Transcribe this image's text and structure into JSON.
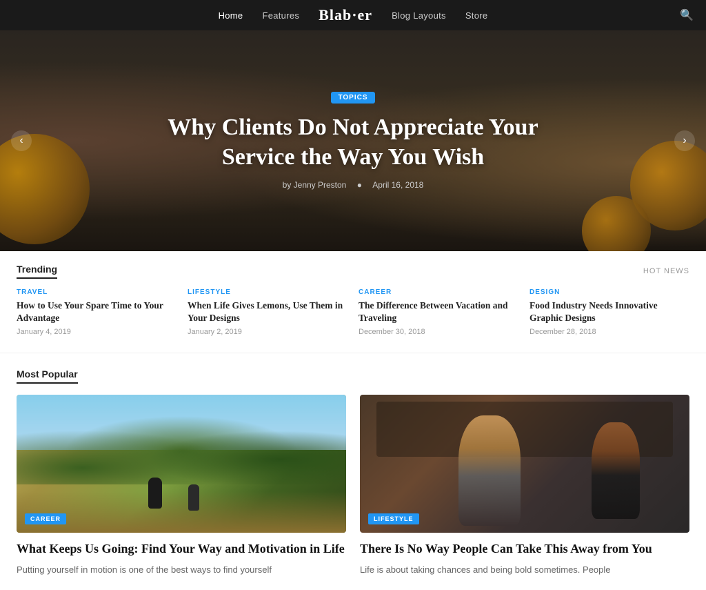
{
  "nav": {
    "links": [
      {
        "label": "Home",
        "active": true
      },
      {
        "label": "Features",
        "active": false
      },
      {
        "label": "Blog Layouts",
        "active": false
      },
      {
        "label": "Store",
        "active": false
      }
    ],
    "logo": "Blab·er",
    "search_icon": "🔍"
  },
  "hero": {
    "tag": "TOPICS",
    "title": "Why Clients Do Not Appreciate Your Service the Way You Wish",
    "author": "by Jenny Preston",
    "date": "April 16, 2018",
    "prev_label": "‹",
    "next_label": "›"
  },
  "trending": {
    "section_title": "Trending",
    "hot_news_label": "HOT NEWS",
    "items": [
      {
        "category": "TRAVEL",
        "title": "How to Use Your Spare Time to Your Advantage",
        "date": "January 4, 2019"
      },
      {
        "category": "LIFESTYLE",
        "title": "When Life Gives Lemons, Use Them in Your Designs",
        "date": "January 2, 2019"
      },
      {
        "category": "CAREER",
        "title": "The Difference Between Vacation and Traveling",
        "date": "December 30, 2018"
      },
      {
        "category": "DESIGN",
        "title": "Food Industry Needs Innovative Graphic Designs",
        "date": "December 28, 2018"
      }
    ]
  },
  "popular": {
    "section_title": "Most Popular",
    "cards": [
      {
        "tag": "CAREER",
        "title": "What Keeps Us Going: Find Your Way and Motivation in Life",
        "excerpt": "Putting yourself in motion is one of the best ways to find yourself",
        "image_type": "running"
      },
      {
        "tag": "LIFESTYLE",
        "title": "There Is No Way People Can Take This Away from You",
        "excerpt": "Life is about taking chances and being bold sometimes. People",
        "image_type": "studio"
      }
    ]
  }
}
